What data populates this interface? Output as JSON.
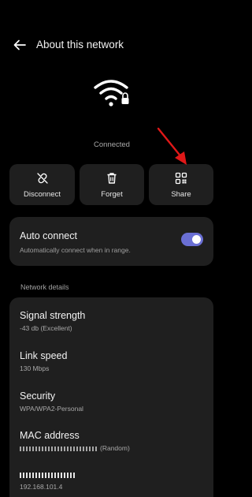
{
  "header": {
    "back_icon": "arrow-left-icon",
    "title": "About this network"
  },
  "hero": {
    "icon": "wifi-lock-icon",
    "status": "Connected"
  },
  "actions": [
    {
      "label": "Disconnect",
      "icon": "link-off-icon"
    },
    {
      "label": "Forget",
      "icon": "trash-icon"
    },
    {
      "label": "Share",
      "icon": "qr-code-icon"
    }
  ],
  "annotation": {
    "icon": "red-arrow-icon",
    "color": "#e01818"
  },
  "auto_connect": {
    "title": "Auto connect",
    "subtitle": "Automatically connect when in range.",
    "enabled": true,
    "toggle_color": "#6a6fd4"
  },
  "network_details": {
    "section_label": "Network details",
    "items": [
      {
        "key": "Signal strength",
        "value": "-43 db (Excellent)"
      },
      {
        "key": "Link speed",
        "value": "130 Mbps"
      },
      {
        "key": "Security",
        "value": "WPA/WPA2-Personal"
      },
      {
        "key": "MAC address",
        "value": "(Random)"
      },
      {
        "key": "",
        "value": "192.168.101.4"
      }
    ]
  }
}
